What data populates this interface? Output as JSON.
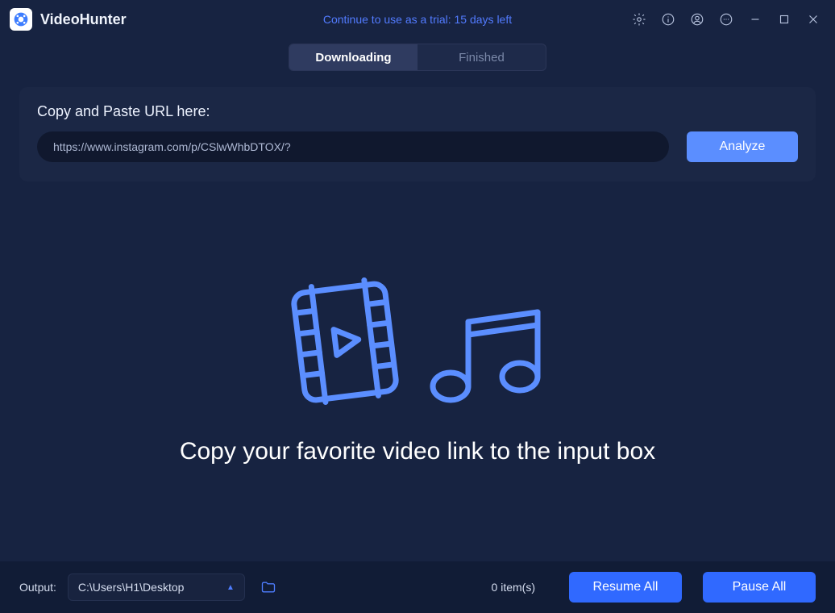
{
  "app": {
    "name": "VideoHunter",
    "trial_text": "Continue to use as a trial: 15 days left"
  },
  "tabs": {
    "downloading": "Downloading",
    "finished": "Finished"
  },
  "url_panel": {
    "label": "Copy and Paste URL here:",
    "value": "https://www.instagram.com/p/CSlwWhbDTOX/?",
    "analyze": "Analyze"
  },
  "empty": {
    "message": "Copy your favorite video link to the input box"
  },
  "footer": {
    "output_label": "Output:",
    "output_path": "C:\\Users\\H1\\Desktop",
    "item_count": "0 item(s)",
    "resume": "Resume All",
    "pause": "Pause All"
  }
}
